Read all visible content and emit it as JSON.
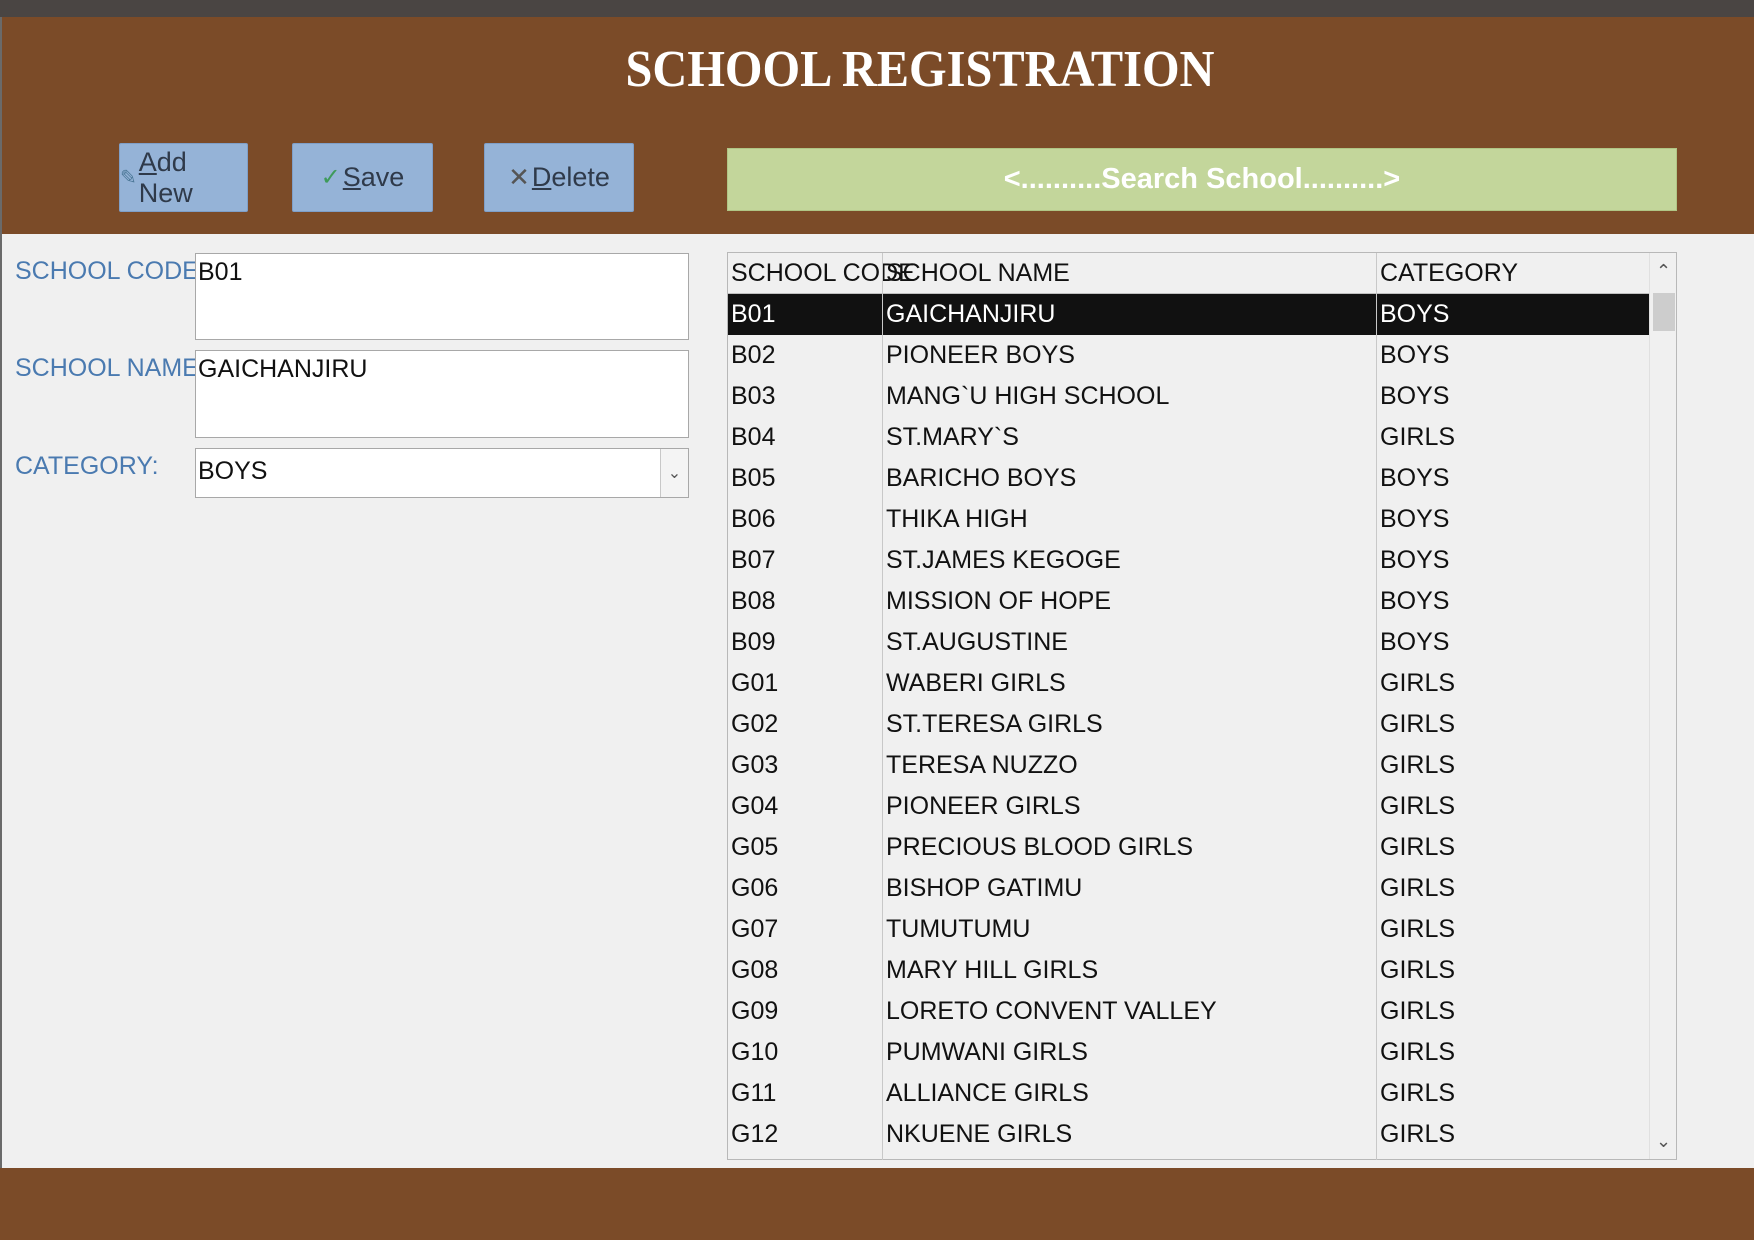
{
  "header": {
    "title": "SCHOOL REGISTRATION"
  },
  "toolbar": {
    "add_icon": "pencil-icon",
    "add_label": "Add New",
    "save_icon": "check-icon",
    "save_label": "Save",
    "delete_icon": "close-icon",
    "delete_label": "Delete",
    "search_label": "<..........Search School..........>"
  },
  "form": {
    "code_label": "SCHOOL CODE",
    "code_value": "B01",
    "name_label": "SCHOOL NAME",
    "name_value": "GAICHANJIRU",
    "category_label": "CATEGORY:",
    "category_value": "BOYS"
  },
  "list": {
    "columns": [
      "SCHOOL CODE",
      "SCHOOL NAME",
      "CATEGORY"
    ],
    "selected_index": 0,
    "rows": [
      [
        "B01",
        "GAICHANJIRU",
        "BOYS"
      ],
      [
        "B02",
        "PIONEER BOYS",
        "BOYS"
      ],
      [
        "B03",
        "MANG`U HIGH SCHOOL",
        "BOYS"
      ],
      [
        "B04",
        "ST.MARY`S",
        "GIRLS"
      ],
      [
        "B05",
        "BARICHO BOYS",
        "BOYS"
      ],
      [
        "B06",
        "THIKA HIGH",
        "BOYS"
      ],
      [
        "B07",
        "ST.JAMES KEGOGE",
        "BOYS"
      ],
      [
        "B08",
        "MISSION OF HOPE",
        "BOYS"
      ],
      [
        "B09",
        "ST.AUGUSTINE",
        "BOYS"
      ],
      [
        "G01",
        "WABERI GIRLS",
        "GIRLS"
      ],
      [
        "G02",
        "ST.TERESA GIRLS",
        "GIRLS"
      ],
      [
        "G03",
        "TERESA NUZZO",
        "GIRLS"
      ],
      [
        "G04",
        "PIONEER GIRLS",
        "GIRLS"
      ],
      [
        "G05",
        "PRECIOUS BLOOD GIRLS",
        "GIRLS"
      ],
      [
        "G06",
        "BISHOP GATIMU",
        "GIRLS"
      ],
      [
        "G07",
        "TUMUTUMU",
        "GIRLS"
      ],
      [
        "G08",
        "MARY HILL GIRLS",
        "GIRLS"
      ],
      [
        "G09",
        "LORETO CONVENT VALLEY",
        "GIRLS"
      ],
      [
        "G10",
        "PUMWANI GIRLS",
        "GIRLS"
      ],
      [
        "G11",
        "ALLIANCE GIRLS",
        "GIRLS"
      ],
      [
        "G12",
        "NKUENE GIRLS",
        "GIRLS"
      ]
    ]
  },
  "colors": {
    "header_bg": "#7b4b28",
    "button_bg": "#95b3d7",
    "search_bg": "#c3d69b",
    "label_color": "#4a7ab0",
    "selected_row_bg": "#111111"
  }
}
